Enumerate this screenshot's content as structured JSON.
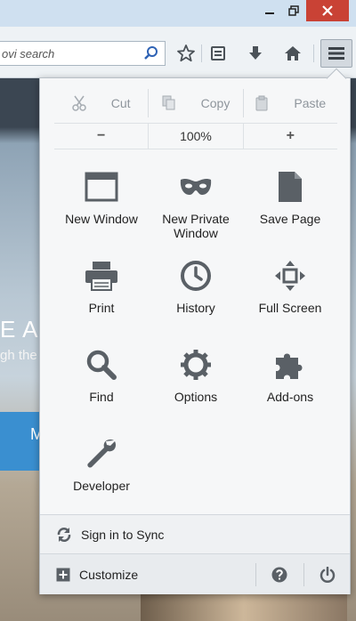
{
  "toolbar": {
    "search_value": "ovi search"
  },
  "background": {
    "headline_fragment": "E AD",
    "subline_fragment": "gh the",
    "band_fragment": "M"
  },
  "menu": {
    "edit": {
      "cut": "Cut",
      "copy": "Copy",
      "paste": "Paste"
    },
    "zoom": {
      "out": "−",
      "level": "100%",
      "in": "+"
    },
    "items": [
      {
        "label": "New Window",
        "icon": "window-icon"
      },
      {
        "label": "New Private Window",
        "icon": "mask-icon"
      },
      {
        "label": "Save Page",
        "icon": "page-icon"
      },
      {
        "label": "Print",
        "icon": "printer-icon"
      },
      {
        "label": "History",
        "icon": "clock-icon"
      },
      {
        "label": "Full Screen",
        "icon": "fullscreen-icon"
      },
      {
        "label": "Find",
        "icon": "magnifier-icon"
      },
      {
        "label": "Options",
        "icon": "gear-icon"
      },
      {
        "label": "Add-ons",
        "icon": "puzzle-icon"
      },
      {
        "label": "Developer",
        "icon": "wrench-icon"
      }
    ],
    "sync_label": "Sign in to Sync",
    "customize_label": "Customize"
  },
  "colors": {
    "icon_gray": "#5a6066",
    "close_red": "#c94235",
    "accent_blue": "#3a8fd0"
  }
}
